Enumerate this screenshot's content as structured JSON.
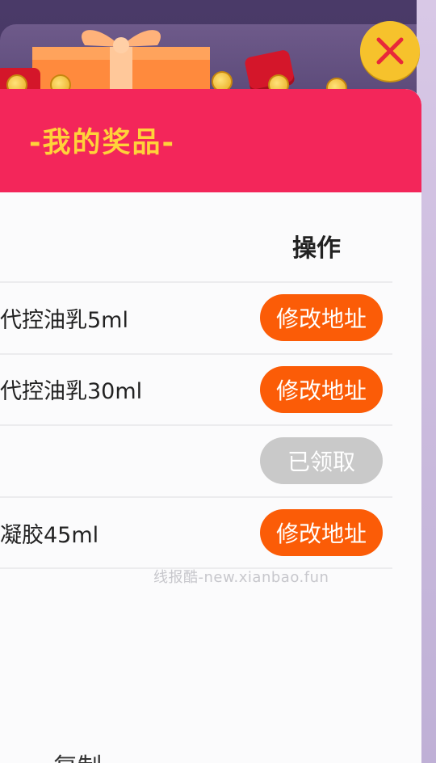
{
  "dialog": {
    "title": "-我的奖品-",
    "column_header": "操作",
    "rows": [
      {
        "prize": "代控油乳5ml",
        "action": "修改地址",
        "state": "editable"
      },
      {
        "prize": "代控油乳30ml",
        "action": "修改地址",
        "state": "editable"
      },
      {
        "prize": "",
        "action": "已领取",
        "state": "claimed"
      },
      {
        "prize": "凝胶45ml",
        "action": "修改地址",
        "state": "editable"
      }
    ],
    "bottom_text_partial": "复制"
  },
  "watermark": "线报酷-new.xianbao.fun",
  "icons": {
    "close": "close-icon"
  },
  "colors": {
    "header_bg": "#f3265a",
    "title": "#ffd23a",
    "action_orange": "#fb5c07",
    "claimed_grey": "#c9c9c9",
    "close_bg": "#f6c22c",
    "close_x": "#e8283a"
  }
}
